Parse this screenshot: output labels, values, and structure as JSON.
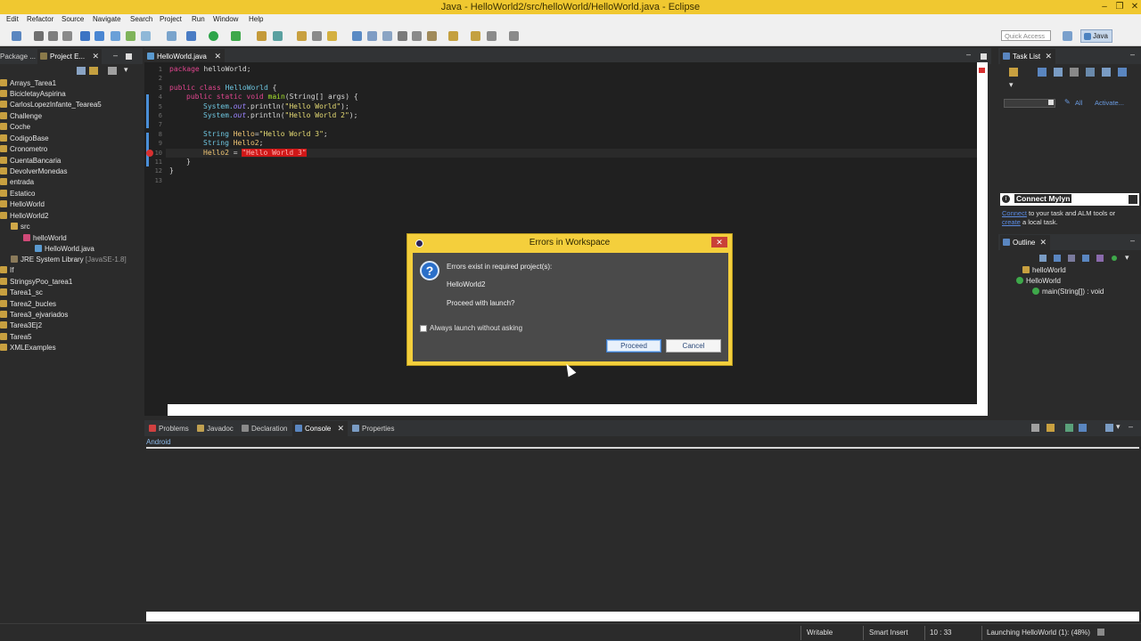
{
  "window": {
    "title": "Java - HelloWorld2/src/helloWorld/HelloWorld.java - Eclipse",
    "minimize": "–",
    "restore": "❐",
    "close": "✕"
  },
  "menu": [
    "Edit",
    "Refactor",
    "Source",
    "Navigate",
    "Search",
    "Project",
    "Run",
    "Window",
    "Help"
  ],
  "toolbar": {
    "quick_access_placeholder": "Quick Access",
    "perspective": "Java"
  },
  "left_panel": {
    "tabs": [
      "Package ...",
      "Project E..."
    ],
    "tree": [
      {
        "label": "Arrays_Tarea1",
        "depth": 0
      },
      {
        "label": "BicicletayAspirina",
        "depth": 0
      },
      {
        "label": "CarlosLopezInfante_Tearea5",
        "depth": 0
      },
      {
        "label": "Challenge",
        "depth": 0
      },
      {
        "label": "Coche",
        "depth": 0
      },
      {
        "label": "CodigoBase",
        "depth": 0
      },
      {
        "label": "Cronometro",
        "depth": 0
      },
      {
        "label": "CuentaBancaria",
        "depth": 0
      },
      {
        "label": "DevolverMonedas",
        "depth": 0
      },
      {
        "label": "entrada",
        "depth": 0
      },
      {
        "label": "Estatico",
        "depth": 0
      },
      {
        "label": "HelloWorld",
        "depth": 0
      },
      {
        "label": "HelloWorld2",
        "depth": 0
      },
      {
        "label": "src",
        "depth": 1
      },
      {
        "label": "helloWorld",
        "depth": 2
      },
      {
        "label": "HelloWorld.java",
        "depth": 3
      },
      {
        "label": "JRE System Library",
        "suffix": "[JavaSE-1.8]",
        "depth": 1
      },
      {
        "label": "If",
        "depth": 0
      },
      {
        "label": "StringsyPoo_tarea1",
        "depth": 0
      },
      {
        "label": "Tarea1_sc",
        "depth": 0
      },
      {
        "label": "Tarea2_bucles",
        "depth": 0
      },
      {
        "label": "Tarea3_ejvariados",
        "depth": 0
      },
      {
        "label": "Tarea3Ej2",
        "depth": 0
      },
      {
        "label": "Tarea5",
        "depth": 0
      },
      {
        "label": "XMLExamples",
        "depth": 0
      }
    ]
  },
  "editor": {
    "tab": "HelloWorld.java",
    "line_numbers": [
      "1",
      "2",
      "3",
      "4",
      "5",
      "6",
      "7",
      "8",
      "9",
      "10",
      "11",
      "12",
      "13"
    ],
    "code": {
      "l1_kw": "package",
      "l1_rest": " helloWorld;",
      "l3_kw1": "public class",
      "l3_name": " HelloWorld",
      "l3_rest": " {",
      "l4_kw": "public static void",
      "l4_mth": " main",
      "l4_rest": "(String[] args) {",
      "l5_cls": "System.",
      "l5_fld": "out",
      "l5_call": ".println(",
      "l5_str": "\"Hello World\"",
      "l5_end": ");",
      "l6_cls": "System.",
      "l6_fld": "out",
      "l6_call": ".println(",
      "l6_str": "\"Hello World 2\"",
      "l6_end": ");",
      "l8_ty": "String",
      "l8_var": " Hello",
      "l8_eq": "=",
      "l8_str": "\"Hello World 3\"",
      "l8_end": ";",
      "l9_ty": "String",
      "l9_var": " Hello2",
      "l9_end": ";",
      "l10_var": "Hello2",
      "l10_eq": " = ",
      "l10_err": "\"Hello World 3\"",
      "l11": "}",
      "l12": "}"
    }
  },
  "right_panel": {
    "task_list_tab": "Task List",
    "filter_all": "All",
    "filter_activate": "Activate...",
    "mylyn_title": "Connect Mylyn",
    "mylyn_link1": "Connect",
    "mylyn_text1": " to your task and ALM tools or",
    "mylyn_link2": "create",
    "mylyn_text2": " a local task.",
    "outline_tab": "Outline",
    "outline_items": [
      "helloWorld",
      "HelloWorld",
      "main(String[]) : void"
    ]
  },
  "bottom_panel": {
    "tabs": [
      "Problems",
      "Javadoc",
      "Declaration",
      "Console",
      "Properties"
    ],
    "console_label": "Android"
  },
  "status": {
    "writable": "Writable",
    "insert_mode": "Smart Insert",
    "position": "10 : 33",
    "progress": "Launching HelloWorld (1): (48%)"
  },
  "dialog": {
    "title": "Errors in Workspace",
    "close": "✕",
    "icon": "?",
    "message": "Errors exist in required project(s):",
    "project": "HelloWorld2",
    "question": "Proceed with launch?",
    "checkbox_label": "Always launch without asking",
    "proceed": "Proceed",
    "cancel": "Cancel"
  },
  "colors": {
    "titlebar": "#f0c830",
    "editor_bg": "#202020",
    "keyword": "#e0458e",
    "string": "#e6db74",
    "error": "#d01818"
  }
}
